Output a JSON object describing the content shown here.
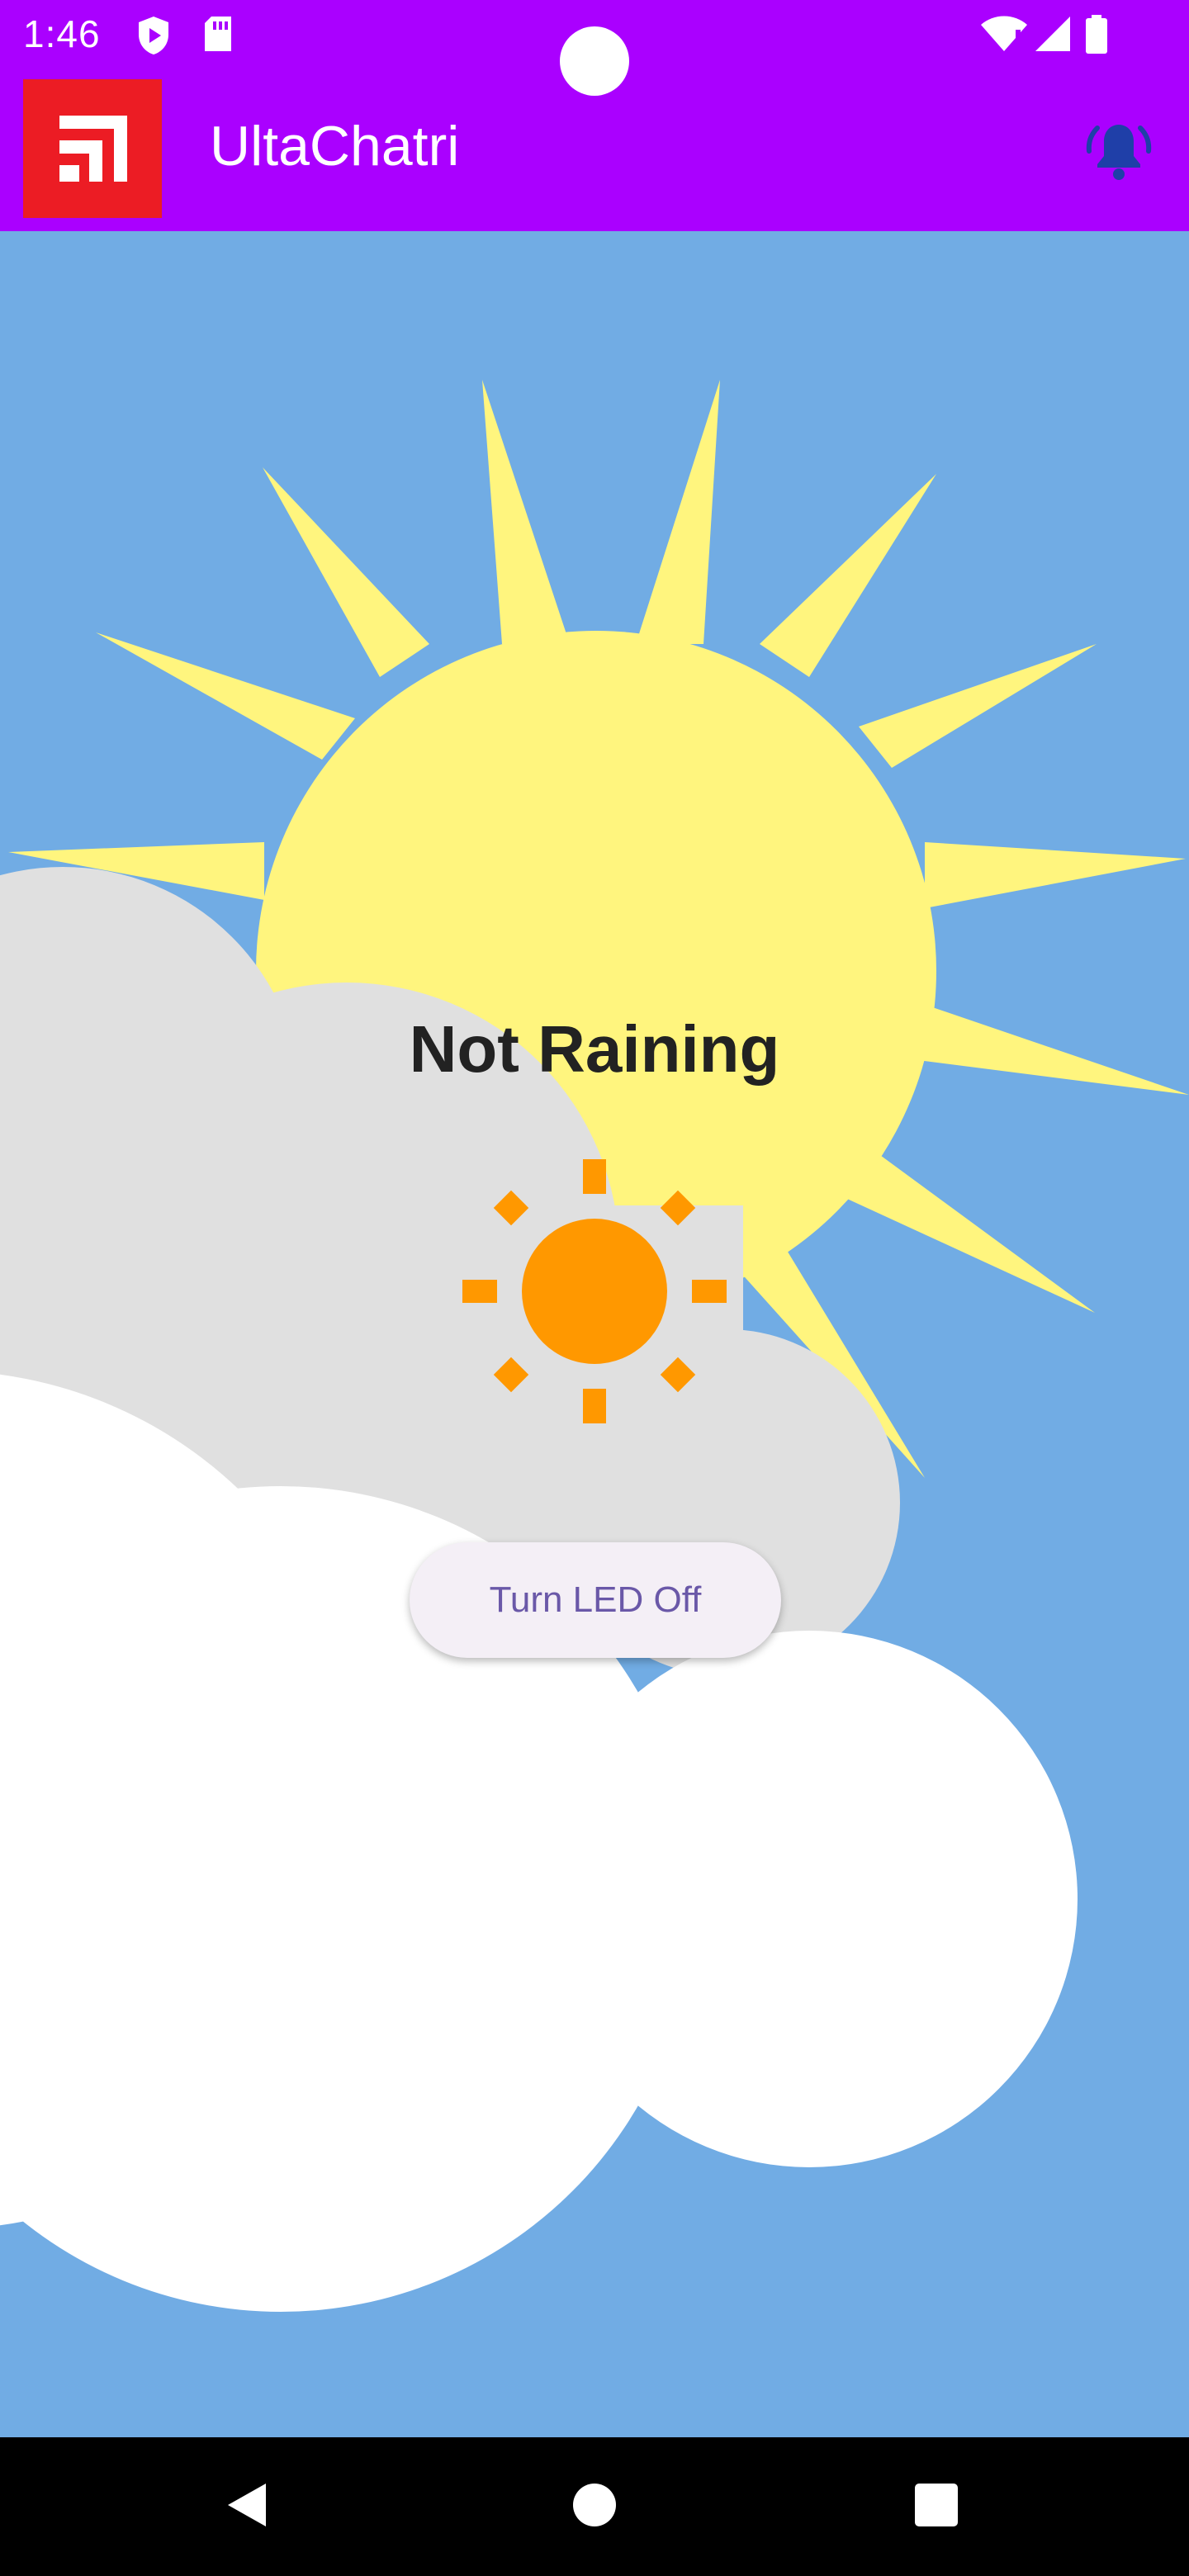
{
  "status_bar": {
    "time": "1:46",
    "icons": [
      "shield-play-icon",
      "sd-card-icon",
      "wifi-alert-icon",
      "signal-icon",
      "battery-icon"
    ]
  },
  "app_bar": {
    "title": "UltaChatri",
    "logo": "ultachatri-logo",
    "action_icon": "bell-ringing-icon",
    "background": "#AA00FF"
  },
  "main": {
    "weather_status": "Not Raining",
    "weather_icon": "sun-icon",
    "led_button_label": "Turn LED Off",
    "background": "#71ACE4"
  },
  "navigation_bar": {
    "buttons": [
      "back-icon",
      "home-icon",
      "recents-icon"
    ]
  }
}
